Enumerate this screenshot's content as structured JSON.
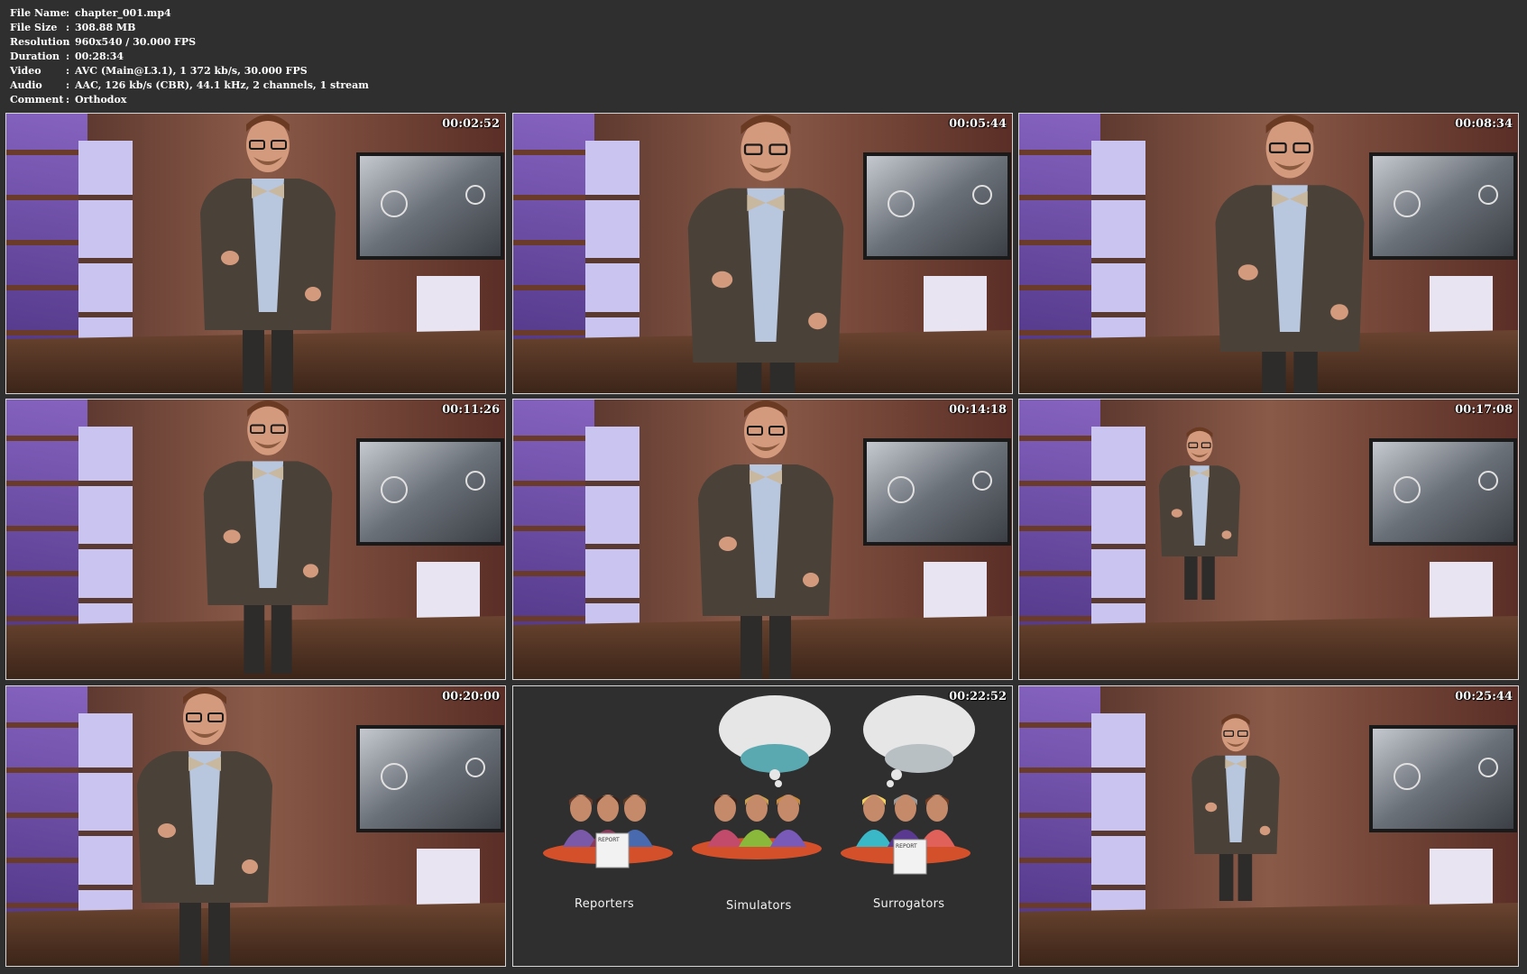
{
  "info": [
    {
      "key": "File Name",
      "value": "chapter_001.mp4"
    },
    {
      "key": "File Size",
      "value": "308.88 MB"
    },
    {
      "key": "Resolution",
      "value": "960x540 / 30.000 FPS"
    },
    {
      "key": "Duration",
      "value": "00:28:34"
    },
    {
      "key": "Video",
      "value": "AVC (Main@L3.1), 1 372 kb/s, 30.000 FPS"
    },
    {
      "key": "Audio",
      "value": "AAC, 126 kb/s (CBR), 44.1 kHz, 2 channels, 1 stream"
    },
    {
      "key": "Comment",
      "value": "Orthodox"
    }
  ],
  "separator": ":",
  "thumbnails": [
    {
      "timestamp": "00:02:52"
    },
    {
      "timestamp": "00:05:44"
    },
    {
      "timestamp": "00:08:34"
    },
    {
      "timestamp": "00:11:26"
    },
    {
      "timestamp": "00:14:18"
    },
    {
      "timestamp": "00:17:08"
    },
    {
      "timestamp": "00:20:00"
    },
    {
      "timestamp": "00:22:52"
    },
    {
      "timestamp": "00:25:44"
    }
  ],
  "graphic": {
    "labels": [
      "Reporters",
      "Simulators",
      "Surrogators"
    ],
    "report_text": "REPORT"
  },
  "colors": {
    "background": "#2f2f2f",
    "frame_border": "#d6d6d6",
    "chalkboard": "#2b2b2b",
    "stage_wall": "#6b3a2e",
    "stage_floor": "#5a3a28",
    "shelf_light": "#7a55c8"
  }
}
